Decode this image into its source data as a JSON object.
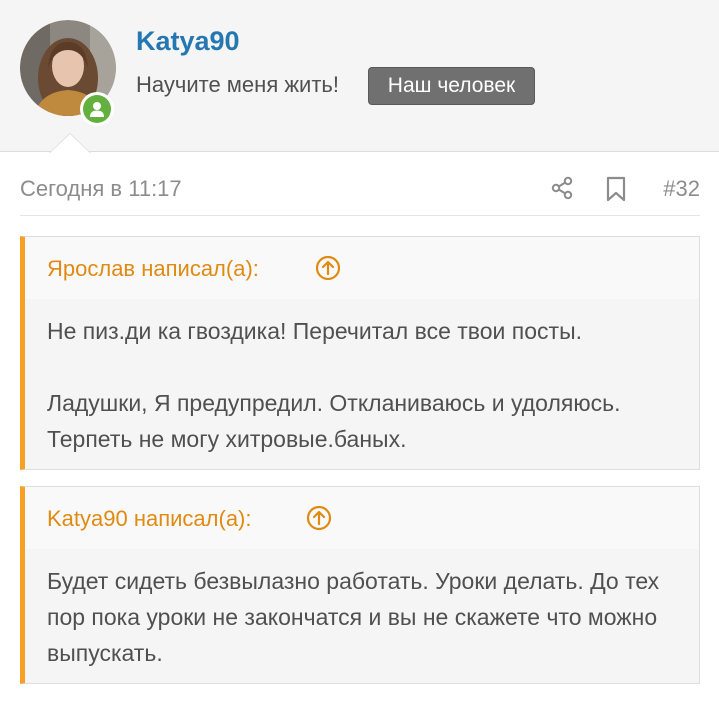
{
  "user": {
    "username": "Katya90",
    "title": "Научите меня жить!",
    "banner": "Наш человек",
    "status": "online"
  },
  "post": {
    "date": "Сегодня в 11:17",
    "number": "#32"
  },
  "quotes": [
    {
      "author_line": "Ярослав написал(а):",
      "paragraphs": [
        "Не пиз.ди ка гвоздика! Перечитал все твои посты.",
        "Ладушки, Я предупредил. Откланиваюсь и удоляюсь. Терпеть не могу хитровые.баных."
      ]
    },
    {
      "author_line": "Katya90 написал(а):",
      "paragraphs": [
        "Будет сидеть безвылазно работать. Уроки делать. До тех пор пока уроки не закончатся и вы не скажете что можно выпускать."
      ]
    }
  ],
  "icons": {
    "share": "share-icon",
    "bookmark": "bookmark-icon",
    "quote_jump": "arrow-up-circle-icon",
    "online": "user-online-icon"
  },
  "colors": {
    "username": "#2577b1",
    "quote_accent": "#f7a023",
    "quote_author": "#e08a12",
    "banner_bg": "#707070",
    "online": "#63b03e"
  }
}
